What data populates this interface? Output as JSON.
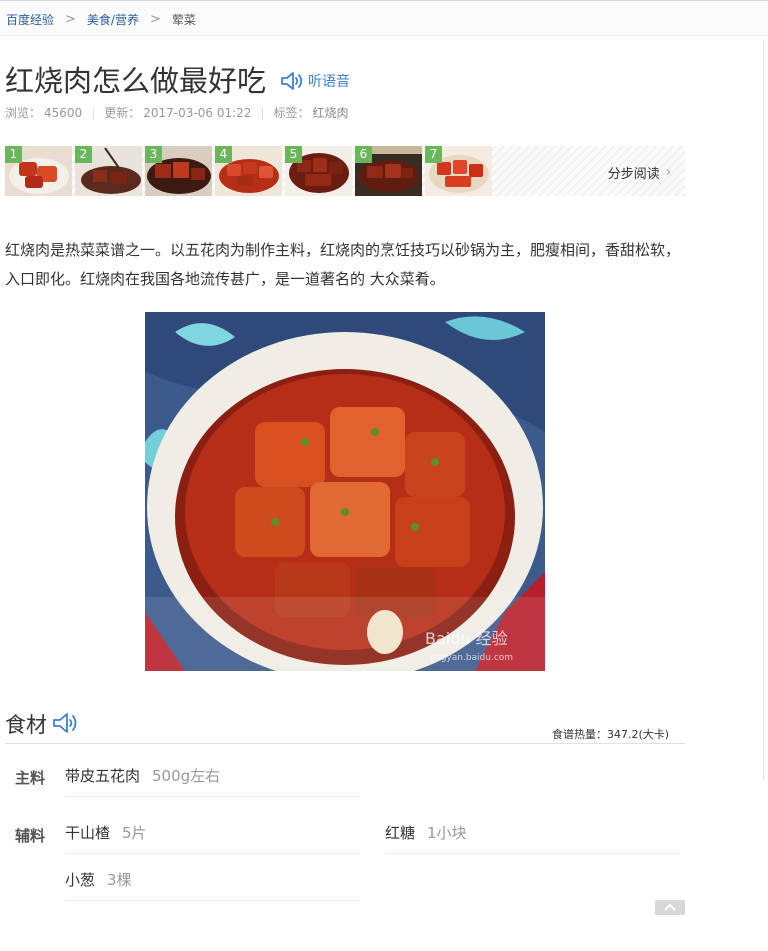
{
  "breadcrumb": {
    "home": "百度经验",
    "category": "美食/营养",
    "current": "荤菜"
  },
  "article": {
    "title": "红烧肉怎么做最好吃",
    "listen_label": "听语音",
    "meta": {
      "views_label": "浏览：",
      "views": "45600",
      "updated_label": "更新：",
      "updated": "2017-03-06 01:22",
      "tags_label": "标签：",
      "tags": "红烧肉"
    },
    "step_numbers": [
      "1",
      "2",
      "3",
      "4",
      "5",
      "6",
      "7"
    ],
    "step_read_label": "分步阅读",
    "intro": "红烧肉是热菜菜谱之一。以五花肉为制作主料，红烧肉的烹饪技巧以砂锅为主，肥瘦相间，香甜松软，入口即化。红烧肉在我国各地流传甚广，是一道著名的 大众菜肴。",
    "image_watermark": "Baidu 经验",
    "image_watermark_url": "jingyan.baidu.com"
  },
  "ingredients": {
    "heading": "食材",
    "calorie": "食谱热量：347.2(大卡)",
    "main_label": "主料",
    "aux_label": "辅料",
    "main": [
      {
        "name": "带皮五花肉",
        "qty": "500g左右"
      }
    ],
    "aux": [
      {
        "name": "干山楂",
        "qty": "5片"
      },
      {
        "name": "红糖",
        "qty": "1小块"
      },
      {
        "name": "小葱",
        "qty": "3棵"
      }
    ]
  },
  "colors": {
    "link": "#2c5e9e",
    "step_badge": "#6ab75b",
    "listen": "#3f7fd0"
  },
  "icons": {
    "listen": "speaker-icon",
    "chevron": "chevron-right-icon",
    "back_to_top": "arrow-up-icon"
  }
}
